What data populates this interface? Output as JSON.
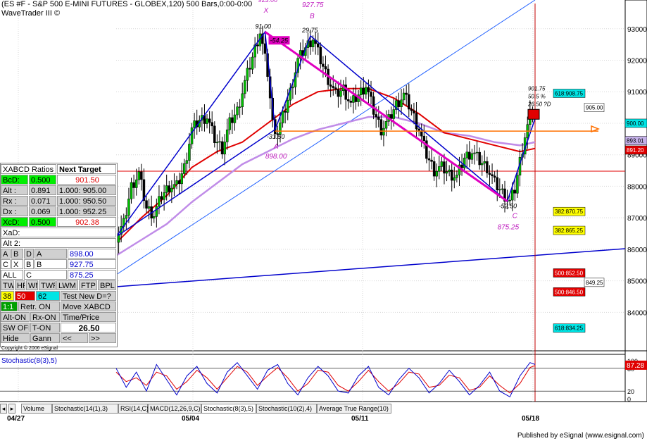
{
  "header": {
    "title": "(ES #F - S&P 500 E-MINI FUTURES - GLOBEX,120) 500 Bars,0:00-0:00",
    "subtitle": "WaveTrader III ©"
  },
  "chart_data": {
    "type": "candlestick",
    "price_axis": {
      "ylim": [
        828,
        938
      ],
      "ticks": [
        840,
        850,
        860,
        870,
        880,
        890,
        900,
        910,
        920,
        930
      ]
    },
    "x_ticks": [
      "04/27",
      "05/04",
      "05/11",
      "05/18"
    ],
    "close_path": [
      [
        0,
        864
      ],
      [
        3,
        868
      ],
      [
        6,
        880
      ],
      [
        9,
        884
      ],
      [
        12,
        873
      ],
      [
        15,
        871
      ],
      [
        18,
        877
      ],
      [
        21,
        880
      ],
      [
        24,
        880
      ],
      [
        27,
        886
      ],
      [
        30,
        898
      ],
      [
        33,
        901
      ],
      [
        36,
        902
      ],
      [
        39,
        895
      ],
      [
        42,
        892
      ],
      [
        45,
        900
      ],
      [
        48,
        904
      ],
      [
        51,
        913
      ],
      [
        54,
        921
      ],
      [
        57,
        929
      ],
      [
        60,
        916
      ],
      [
        62,
        900
      ],
      [
        64,
        897
      ],
      [
        66,
        902
      ],
      [
        69,
        910
      ],
      [
        72,
        920
      ],
      [
        75,
        924
      ],
      [
        78,
        927
      ],
      [
        81,
        920
      ],
      [
        84,
        914
      ],
      [
        87,
        909
      ],
      [
        90,
        911
      ],
      [
        93,
        906
      ],
      [
        96,
        909
      ],
      [
        99,
        912
      ],
      [
        102,
        904
      ],
      [
        105,
        898
      ],
      [
        108,
        901
      ],
      [
        111,
        906
      ],
      [
        114,
        909
      ],
      [
        117,
        904
      ],
      [
        120,
        898
      ],
      [
        123,
        890
      ],
      [
        126,
        885
      ],
      [
        129,
        886
      ],
      [
        132,
        884
      ],
      [
        135,
        883
      ],
      [
        138,
        889
      ],
      [
        141,
        891
      ],
      [
        144,
        888
      ],
      [
        147,
        886
      ],
      [
        150,
        881
      ],
      [
        153,
        878
      ],
      [
        156,
        875
      ],
      [
        158,
        879
      ],
      [
        160,
        888
      ],
      [
        162,
        896
      ],
      [
        164,
        902
      ],
      [
        166,
        904
      ]
    ],
    "ma_red": [
      [
        0,
        862
      ],
      [
        10,
        870
      ],
      [
        20,
        877
      ],
      [
        30,
        886
      ],
      [
        40,
        891
      ],
      [
        50,
        894
      ],
      [
        60,
        900
      ],
      [
        70,
        906
      ],
      [
        80,
        910
      ],
      [
        90,
        911
      ],
      [
        100,
        911
      ],
      [
        110,
        908
      ],
      [
        120,
        903
      ],
      [
        130,
        897
      ],
      [
        140,
        895
      ],
      [
        150,
        893
      ],
      [
        160,
        891
      ],
      [
        166,
        892
      ]
    ],
    "ma_violet": [
      [
        0,
        858
      ],
      [
        10,
        863
      ],
      [
        20,
        868
      ],
      [
        30,
        875
      ],
      [
        40,
        881
      ],
      [
        50,
        887
      ],
      [
        60,
        891
      ],
      [
        70,
        895
      ],
      [
        80,
        898
      ],
      [
        90,
        900
      ],
      [
        100,
        902
      ],
      [
        110,
        902
      ],
      [
        120,
        900
      ],
      [
        130,
        897
      ],
      [
        140,
        896
      ],
      [
        150,
        894
      ],
      [
        160,
        893
      ],
      [
        166,
        894
      ]
    ],
    "pattern": {
      "X": {
        "x": 59,
        "y": 929,
        "label": "X",
        "value": "91.00",
        "top": "923.00"
      },
      "A": {
        "x": 63,
        "y": 898,
        "label": "A",
        "value": "-31.50",
        "price": "898.00"
      },
      "B": {
        "x": 77,
        "y": 927.75,
        "label": "B",
        "value": "29.75",
        "price": "927.75"
      },
      "C": {
        "x": 155,
        "y": 875.25,
        "label": "C",
        "value": "-52.50",
        "price": "875.25"
      },
      "D": {
        "x": 166,
        "y": 901.5,
        "notes": [
          "901.75",
          "50.5 %",
          "26.50 ?D"
        ]
      },
      "xa_tag": "-54.25"
    },
    "price_labels": [
      {
        "text": "618:908.75",
        "price": 909.5,
        "bg": "#00e5e5",
        "tc": "#000"
      },
      {
        "text": "905.00",
        "price": 905,
        "bg": "#ffffff",
        "tc": "#000"
      },
      {
        "text": "900.00",
        "price": 900,
        "bg": "#00e5e5",
        "tc": "#000"
      },
      {
        "text": "893.01",
        "price": 894.5,
        "bg": "#c4b0e8",
        "tc": "#000"
      },
      {
        "text": "891.20",
        "price": 891.5,
        "bg": "#e00000",
        "tc": "#fff"
      },
      {
        "text": "382:870.75",
        "price": 872,
        "bg": "#ffff00",
        "tc": "#000"
      },
      {
        "text": "382:865.25",
        "price": 866,
        "bg": "#ffff00",
        "tc": "#000"
      },
      {
        "text": "500:852.50",
        "price": 852.5,
        "bg": "#e00000",
        "tc": "#fff"
      },
      {
        "text": "849.25",
        "price": 849.5,
        "bg": "#ffffff",
        "tc": "#000"
      },
      {
        "text": "500:846.50",
        "price": 846.5,
        "bg": "#e00000",
        "tc": "#fff"
      },
      {
        "text": "618:834.25",
        "price": 835,
        "bg": "#00e5e5",
        "tc": "#000"
      }
    ],
    "stochastic": {
      "title": "Stochastic(8(3),5)",
      "value": "87.28",
      "ticks": [
        "100",
        "80",
        "20",
        "0"
      ],
      "k": [
        [
          0,
          80
        ],
        [
          4,
          30
        ],
        [
          8,
          70
        ],
        [
          12,
          20
        ],
        [
          16,
          90
        ],
        [
          20,
          50
        ],
        [
          24,
          10
        ],
        [
          28,
          60
        ],
        [
          32,
          85
        ],
        [
          36,
          40
        ],
        [
          40,
          15
        ],
        [
          44,
          70
        ],
        [
          48,
          95
        ],
        [
          52,
          60
        ],
        [
          56,
          25
        ],
        [
          60,
          75
        ],
        [
          64,
          90
        ],
        [
          68,
          40
        ],
        [
          72,
          10
        ],
        [
          76,
          55
        ],
        [
          80,
          85
        ],
        [
          84,
          60
        ],
        [
          88,
          20
        ],
        [
          92,
          15
        ],
        [
          96,
          60
        ],
        [
          100,
          85
        ],
        [
          104,
          30
        ],
        [
          108,
          10
        ],
        [
          112,
          50
        ],
        [
          116,
          80
        ],
        [
          120,
          55
        ],
        [
          124,
          15
        ],
        [
          128,
          40
        ],
        [
          132,
          75
        ],
        [
          136,
          45
        ],
        [
          140,
          10
        ],
        [
          144,
          35
        ],
        [
          148,
          70
        ],
        [
          152,
          20
        ],
        [
          156,
          5
        ],
        [
          160,
          60
        ],
        [
          164,
          95
        ],
        [
          166,
          90
        ]
      ],
      "d": [
        [
          0,
          70
        ],
        [
          4,
          45
        ],
        [
          8,
          55
        ],
        [
          12,
          35
        ],
        [
          16,
          70
        ],
        [
          20,
          60
        ],
        [
          24,
          25
        ],
        [
          28,
          45
        ],
        [
          32,
          75
        ],
        [
          36,
          55
        ],
        [
          40,
          25
        ],
        [
          44,
          55
        ],
        [
          48,
          85
        ],
        [
          52,
          70
        ],
        [
          56,
          35
        ],
        [
          60,
          60
        ],
        [
          64,
          82
        ],
        [
          68,
          55
        ],
        [
          72,
          20
        ],
        [
          76,
          40
        ],
        [
          80,
          75
        ],
        [
          84,
          70
        ],
        [
          88,
          35
        ],
        [
          92,
          20
        ],
        [
          96,
          45
        ],
        [
          100,
          75
        ],
        [
          104,
          45
        ],
        [
          108,
          20
        ],
        [
          112,
          40
        ],
        [
          116,
          70
        ],
        [
          120,
          65
        ],
        [
          124,
          30
        ],
        [
          128,
          35
        ],
        [
          132,
          62
        ],
        [
          136,
          55
        ],
        [
          140,
          22
        ],
        [
          144,
          30
        ],
        [
          148,
          60
        ],
        [
          152,
          35
        ],
        [
          156,
          15
        ],
        [
          160,
          40
        ],
        [
          164,
          82
        ],
        [
          166,
          87
        ]
      ]
    },
    "tabs": [
      "Volume",
      "Stochastic(14(1),3)",
      "RSI(14,C)",
      "MACD(12,26,9,C)",
      "Stochastic(8(3),5)",
      "Stochastic(10(2),4)",
      "Average True Range(10)"
    ]
  },
  "panel": {
    "rows": [
      [
        {
          "t": "XABCD Ratios",
          "bg": "#ffffff",
          "c": "#000",
          "w": 80
        },
        {
          "t": "Next Target",
          "bg": "#ffffff",
          "c": "#000",
          "w": 85,
          "bold": true
        }
      ],
      [
        {
          "t": "BcD:",
          "bg": "#00ee00",
          "c": "#000",
          "w": 40
        },
        {
          "t": "0.500",
          "bg": "#00ee00",
          "c": "#000",
          "w": 40
        },
        {
          "t": "901.50",
          "bg": "#ffffff",
          "c": "#e00000",
          "w": 85,
          "align": "center"
        }
      ],
      [
        {
          "t": "Alt :",
          "bg": "#d0d0d0",
          "c": "#000",
          "w": 40
        },
        {
          "t": "0.891",
          "bg": "#d0d0d0",
          "c": "#000",
          "w": 40
        },
        {
          "t": "1.000: 905.00",
          "bg": "#d0d0d0",
          "c": "#000",
          "w": 85
        }
      ],
      [
        {
          "t": "Rx :",
          "bg": "#d0d0d0",
          "c": "#000",
          "w": 40
        },
        {
          "t": "0.071",
          "bg": "#d0d0d0",
          "c": "#000",
          "w": 40
        },
        {
          "t": "1.000: 950.50",
          "bg": "#d0d0d0",
          "c": "#000",
          "w": 85
        }
      ],
      [
        {
          "t": "Dx :",
          "bg": "#d0d0d0",
          "c": "#000",
          "w": 40
        },
        {
          "t": "0.069",
          "bg": "#d0d0d0",
          "c": "#000",
          "w": 40
        },
        {
          "t": "1.000: 952.25",
          "bg": "#d0d0d0",
          "c": "#000",
          "w": 85
        }
      ],
      [
        {
          "t": "XcD:",
          "bg": "#00ee00",
          "c": "#000",
          "w": 40
        },
        {
          "t": "0.500",
          "bg": "#00ee00",
          "c": "#000",
          "w": 40
        },
        {
          "t": "902.38",
          "bg": "#ffffff",
          "c": "#e00000",
          "w": 85,
          "align": "center"
        }
      ],
      [
        {
          "t": "XaD:",
          "bg": "#ffffff",
          "c": "#000",
          "w": 165
        }
      ],
      [
        {
          "t": "Alt 2:",
          "bg": "#ffffff",
          "c": "#000",
          "w": 165
        }
      ],
      [
        {
          "t": "A",
          "bg": "#d0d0d0",
          "c": "#000",
          "w": 15
        },
        {
          "t": "B",
          "bg": "#d0d0d0",
          "c": "#000",
          "w": 18
        },
        {
          "t": "D",
          "bg": "#d0d0d0",
          "c": "#000",
          "w": 15
        },
        {
          "t": "A",
          "bg": "#d0d0d0",
          "c": "#000",
          "w": 47
        },
        {
          "t": "898.00",
          "bg": "#ffffff",
          "c": "#0000cc",
          "w": 70
        }
      ],
      [
        {
          "t": "C",
          "bg": "#ffffff",
          "c": "#000",
          "w": 15
        },
        {
          "t": "X",
          "bg": "#ffffff",
          "c": "#000",
          "w": 18
        },
        {
          "t": "B",
          "bg": "#ffffff",
          "c": "#000",
          "w": 15
        },
        {
          "t": "B",
          "bg": "#ffffff",
          "c": "#000",
          "w": 47
        },
        {
          "t": "927.75",
          "bg": "#ffffff",
          "c": "#0000cc",
          "w": 70
        }
      ],
      [
        {
          "t": "ALL",
          "bg": "#ffffff",
          "c": "#000",
          "w": 33
        },
        {
          "t": "C",
          "bg": "#ffffff",
          "c": "#000",
          "w": 62
        },
        {
          "t": "875.25",
          "bg": "#ffffff",
          "c": "#0000cc",
          "w": 70
        }
      ],
      [
        {
          "t": "TW",
          "bg": "#d0d0d0",
          "c": "#000",
          "w": 20
        },
        {
          "t": "HR",
          "bg": "#d0d0d0",
          "c": "#000",
          "w": 16
        },
        {
          "t": "WM",
          "bg": "#d0d0d0",
          "c": "#000",
          "w": 18
        },
        {
          "t": "TWF",
          "bg": "#d0d0d0",
          "c": "#000",
          "w": 25
        },
        {
          "t": "LWM",
          "bg": "#d0d0d0",
          "c": "#000",
          "w": 32
        },
        {
          "t": "FTP",
          "bg": "#d0d0d0",
          "c": "#000",
          "w": 27
        },
        {
          "t": "BPL",
          "bg": "#d0d0d0",
          "c": "#000",
          "w": 27
        }
      ],
      [
        {
          "t": "38",
          "bg": "#ffff00",
          "c": "#000",
          "w": 20
        },
        {
          "t": "50",
          "bg": "#e00000",
          "c": "#fff",
          "w": 30
        },
        {
          "t": "62",
          "bg": "#00e5e5",
          "c": "#000",
          "w": 35
        },
        {
          "t": "Test New D=?",
          "bg": "#d0d0d0",
          "c": "#000",
          "w": 80
        }
      ],
      [
        {
          "t": "1:1",
          "bg": "#00a000",
          "c": "#fff",
          "w": 25
        },
        {
          "t": "Retr. ON",
          "bg": "#d0d0d0",
          "c": "#000",
          "w": 60
        },
        {
          "t": "Move XABCD",
          "bg": "#d0d0d0",
          "c": "#000",
          "w": 80
        }
      ],
      [
        {
          "t": "Alt-ON",
          "bg": "#d0d0d0",
          "c": "#000",
          "w": 42
        },
        {
          "t": "Rx-ON",
          "bg": "#d0d0d0",
          "c": "#000",
          "w": 43
        },
        {
          "t": "Time/Price",
          "bg": "#d0d0d0",
          "c": "#000",
          "w": 80
        }
      ],
      [
        {
          "t": "SW OFF",
          "bg": "#d0d0d0",
          "c": "#000",
          "w": 42
        },
        {
          "t": "T-ON",
          "bg": "#d0d0d0",
          "c": "#000",
          "w": 43
        },
        {
          "t": "26.50",
          "bg": "#ffffff",
          "c": "#000",
          "w": 80,
          "bold": true,
          "big": true
        }
      ],
      [
        {
          "t": "Hide",
          "bg": "#d0d0d0",
          "c": "#000",
          "w": 42
        },
        {
          "t": "Gann",
          "bg": "#d0d0d0",
          "c": "#000",
          "w": 43
        },
        {
          "t": "<<",
          "bg": "#d0d0d0",
          "c": "#000",
          "w": 40
        },
        {
          "t": ">>",
          "bg": "#d0d0d0",
          "c": "#000",
          "w": 40
        }
      ]
    ],
    "copyright": "Copyright © 2006 eSignal"
  },
  "footer": "Published by eSignal (www.esignal.com)"
}
